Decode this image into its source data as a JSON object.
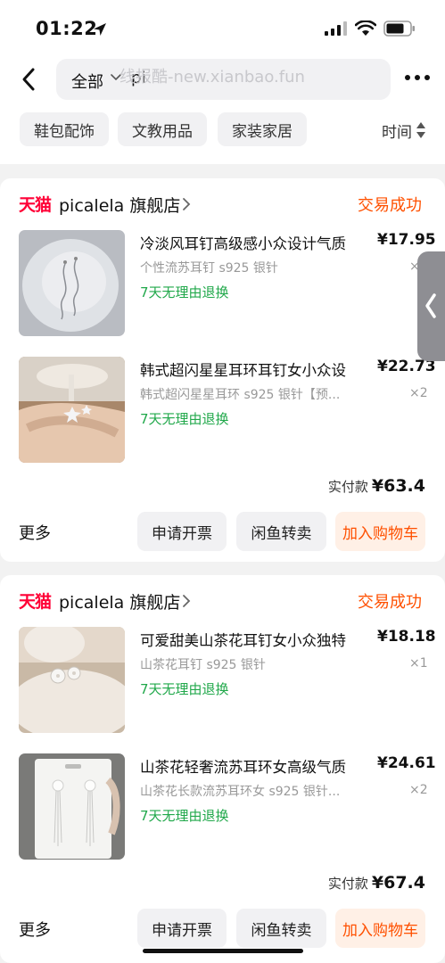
{
  "status_bar": {
    "time": "01:22"
  },
  "search": {
    "scope": "全部",
    "query": "pi",
    "watermark": "线报酷-new.xianbao.fun"
  },
  "filters": {
    "chips": [
      "鞋包配饰",
      "文教用品",
      "家装家居"
    ],
    "sort_label": "时间"
  },
  "orders": [
    {
      "shop_logo": "天猫",
      "shop_name": "picalela 旗舰店",
      "status": "交易成功",
      "items": [
        {
          "title": "冷淡风耳钉高级感小众设计气质",
          "price": "¥17.95",
          "sku": "个性流苏耳钉  s925 银针",
          "qty": "×",
          "return_policy": "7天无理由退换"
        },
        {
          "title": "韩式超闪星星耳环耳钉女小众设",
          "price": "¥22.73",
          "sku": "韩式超闪星星耳环  s925 银针【预...",
          "qty": "×2",
          "return_policy": "7天无理由退换"
        }
      ],
      "paid_label": "实付款",
      "paid_amount": "¥63.4",
      "more_label": "更多",
      "actions": {
        "invoice": "申请开票",
        "resell": "闲鱼转卖",
        "cart": "加入购物车"
      }
    },
    {
      "shop_logo": "天猫",
      "shop_name": "picalela 旗舰店",
      "status": "交易成功",
      "items": [
        {
          "title": "可爱甜美山茶花耳钉女小众独特",
          "price": "¥18.18",
          "sku": "山茶花耳钉    s925 银针",
          "qty": "×1",
          "return_policy": "7天无理由退换"
        },
        {
          "title": "山茶花轻奢流苏耳环女高级气质",
          "price": "¥24.61",
          "sku": "山茶花长款流苏耳环女  s925 银针...",
          "qty": "×2",
          "return_policy": "7天无理由退换"
        }
      ],
      "paid_label": "实付款",
      "paid_amount": "¥67.4",
      "more_label": "更多",
      "actions": {
        "invoice": "申请开票",
        "resell": "闲鱼转卖",
        "cart": "加入购物车"
      }
    }
  ],
  "colors": {
    "accent": "#ff5000",
    "tmall_red": "#ff0036",
    "return_green": "#20a84a"
  },
  "icons": [
    "location-arrow-icon",
    "signal-icon",
    "wifi-icon",
    "battery-icon",
    "back-arrow-icon",
    "chevron-down-icon",
    "more-dots-icon",
    "sort-arrows-icon",
    "chevron-right-icon",
    "side-handle-chevron-icon"
  ]
}
